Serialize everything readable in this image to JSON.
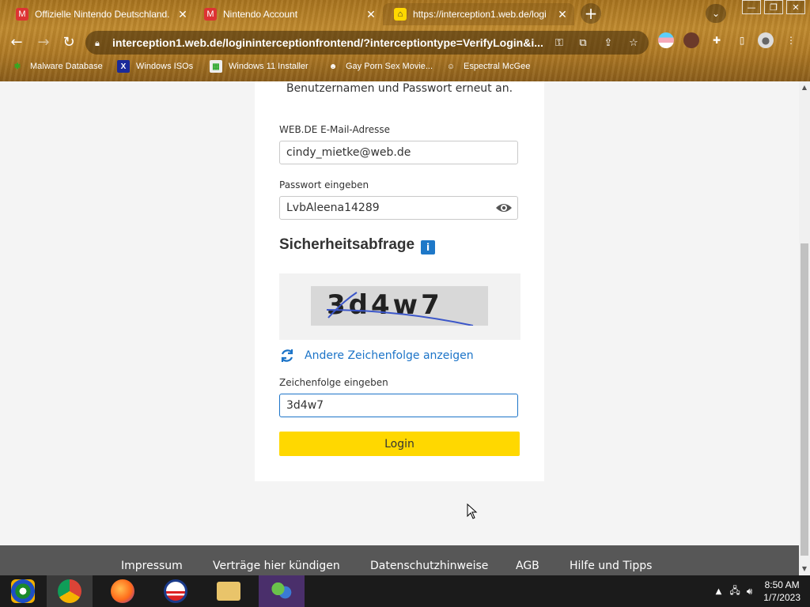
{
  "browser": {
    "tabs": [
      {
        "title": "Offizielle Nintendo Deutschland...",
        "active": false
      },
      {
        "title": "Nintendo Account",
        "active": false
      },
      {
        "title": "https://interception1.web.de/logi",
        "active": true
      }
    ],
    "new_tab_symbol": "+",
    "url": "interception1.web.de/logininterceptionfrontend/?interceptiontype=VerifyLogin&i...",
    "bookmarks": [
      {
        "label": "Malware Database",
        "icon": "bug-icon"
      },
      {
        "label": "Windows ISOs",
        "icon": "x-icon"
      },
      {
        "label": "Windows 11 Installer",
        "icon": "image-icon"
      },
      {
        "label": "Gay Porn Sex Movie...",
        "icon": "mask-icon"
      },
      {
        "label": "Espectral McGee",
        "icon": "face-icon"
      }
    ]
  },
  "login": {
    "intro_text": "Benutzernamen und Passwort erneut an.",
    "email_label": "WEB.DE E-Mail-Adresse",
    "email_value": "cindy_mietke@web.de",
    "password_label": "Passwort eingeben",
    "password_value": "LvbAleena14289",
    "security_heading": "Sicherheitsabfrage",
    "info_symbol": "i",
    "captcha_text": "3d4w7",
    "refresh_label": "Andere Zeichenfolge anzeigen",
    "code_label": "Zeichenfolge eingeben",
    "code_value": "3d4w7",
    "login_button": "Login"
  },
  "footer": {
    "links": [
      "Impressum",
      "Verträge hier kündigen",
      "Datenschutzhinweise",
      "AGB",
      "Hilfe und Tipps"
    ]
  },
  "taskbar": {
    "time": "8:50 AM",
    "date": "1/7/2023"
  },
  "colors": {
    "accent_blue": "#1c74c8",
    "login_yellow": "#ffd800",
    "footer_gray": "#575757"
  }
}
